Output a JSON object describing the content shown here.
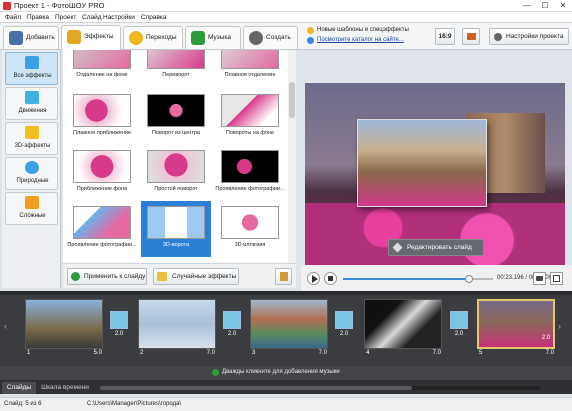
{
  "window": {
    "title": "Проект 1 - ФотоШОУ PRO",
    "min": "—",
    "max": "☐",
    "close": "✕"
  },
  "menu": [
    "Файл",
    "Правка",
    "Проект",
    "Слайд",
    "Настройки",
    "Справка"
  ],
  "tabs": [
    {
      "label": "Добавить",
      "icon": "add-photo-icon",
      "color": "#4a6fa8"
    },
    {
      "label": "Эффекты",
      "icon": "effects-wand-icon",
      "color": "#e0a820"
    },
    {
      "label": "Переходы",
      "icon": "star-icon",
      "color": "#f0b820"
    },
    {
      "label": "Музыка",
      "icon": "music-note-icon",
      "color": "#2e9b3c"
    },
    {
      "label": "Создать",
      "icon": "film-reel-icon",
      "color": "#555"
    }
  ],
  "categories": [
    {
      "label": "Все эффекты",
      "icon": "all-effects-icon",
      "color": "#3aa0e8"
    },
    {
      "label": "Движения",
      "icon": "movement-icon",
      "color": "#3fb0e0"
    },
    {
      "label": "3D-эффекты",
      "icon": "3d-cube-icon",
      "color": "#f0c020"
    },
    {
      "label": "Природные",
      "icon": "nature-icon",
      "color": "#3aa0e8"
    },
    {
      "label": "Сложные",
      "icon": "complex-icon",
      "color": "#f0a020"
    }
  ],
  "effects": [
    {
      "label": "Отдаление на фоне"
    },
    {
      "label": "Переворот"
    },
    {
      "label": "Плавное отдаление"
    },
    {
      "label": "Плавное приближение"
    },
    {
      "label": "Поворот из центра"
    },
    {
      "label": "Повороты на фоне"
    },
    {
      "label": "Приближение фона"
    },
    {
      "label": "Простой поворот"
    },
    {
      "label": "Проявление фотографии..."
    },
    {
      "label": "Проявление фотографии..."
    },
    {
      "label": "3D-ворота"
    },
    {
      "label": "3D иллюзия"
    }
  ],
  "bottom": {
    "apply": "Применить к слайду",
    "random": "Случайные эффекты"
  },
  "promo": {
    "line1": "Новые шаблоны и спецэффекты",
    "line2": "Посмотрите каталог на сайте..."
  },
  "ratio": "16:9",
  "settings": "Настройки проекта",
  "edit_slide": "Редактировать слайд",
  "time": "00:23.196 / 00:30.000",
  "progress": 0.84,
  "slides": [
    {
      "num": "1",
      "dur": "5.0"
    },
    {
      "num": "2",
      "dur": "7.0"
    },
    {
      "num": "3",
      "dur": "7.0"
    },
    {
      "num": "4",
      "dur": "7.0"
    },
    {
      "num": "5",
      "dur": "7.0"
    }
  ],
  "transitions": [
    "2.0",
    "2.0",
    "2.0",
    "2.0",
    "2.0"
  ],
  "music_hint": "Дважды кликните для добавления музыки",
  "tl_tabs": [
    "Слайды",
    "Шкала времени"
  ],
  "status": {
    "slide": "Слайд: 5 из 6",
    "path": "C:\\Users\\Manager\\Pictures\\города\\"
  },
  "colors": {
    "accent": "#2b7fd4",
    "active_slide": "#e6c86c",
    "flower": "#d83a8a"
  }
}
